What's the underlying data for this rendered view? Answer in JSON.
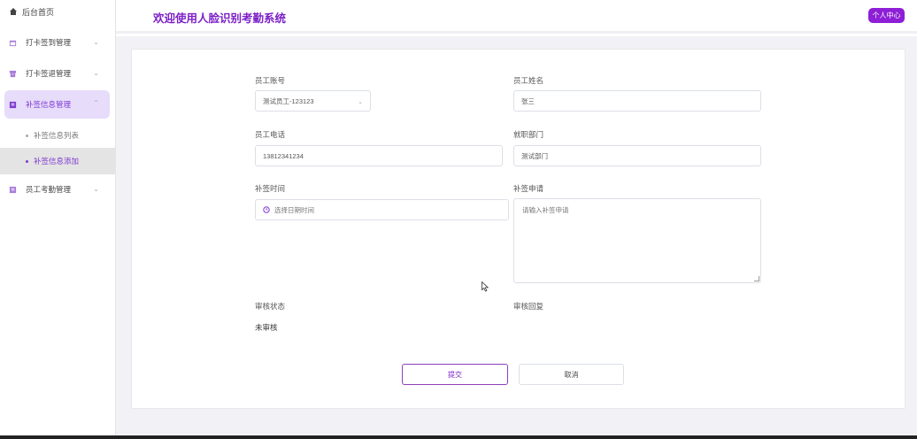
{
  "sidebar": {
    "home": {
      "label": "后台首页",
      "icon": "home-icon"
    },
    "items": [
      {
        "label": "打卡签到管理",
        "icon": "calendar-icon"
      },
      {
        "label": "打卡签退管理",
        "icon": "archive-icon"
      },
      {
        "label": "补签信息管理",
        "icon": "document-icon",
        "expanded": true
      },
      {
        "label": "员工考勤管理",
        "icon": "document-icon"
      }
    ],
    "subitems": [
      {
        "label": "补签信息列表"
      },
      {
        "label": "补签信息添加",
        "active": true
      }
    ]
  },
  "header": {
    "title": "欢迎使用人脸识别考勤系统",
    "profile_button": "个人中心"
  },
  "form": {
    "employee_account": {
      "label": "员工账号",
      "value": "测试员工-123123"
    },
    "employee_name": {
      "label": "员工姓名",
      "value": "张三"
    },
    "employee_phone": {
      "label": "员工电话",
      "value": "13812341234"
    },
    "department": {
      "label": "就职部门",
      "value": "测试部门"
    },
    "resign_time": {
      "label": "补签时间",
      "placeholder": "选择日期时间"
    },
    "resign_request": {
      "label": "补签申请",
      "placeholder": "请输入补签申请"
    },
    "review_status": {
      "label": "审核状态",
      "value": "未审核"
    },
    "review_reply": {
      "label": "审核回复"
    },
    "submit_label": "提交",
    "cancel_label": "取消"
  },
  "colors": {
    "accent": "#7b1fc7",
    "profile_button": "#8e1fd6",
    "active_menu_bg": "#e7dcfa"
  }
}
